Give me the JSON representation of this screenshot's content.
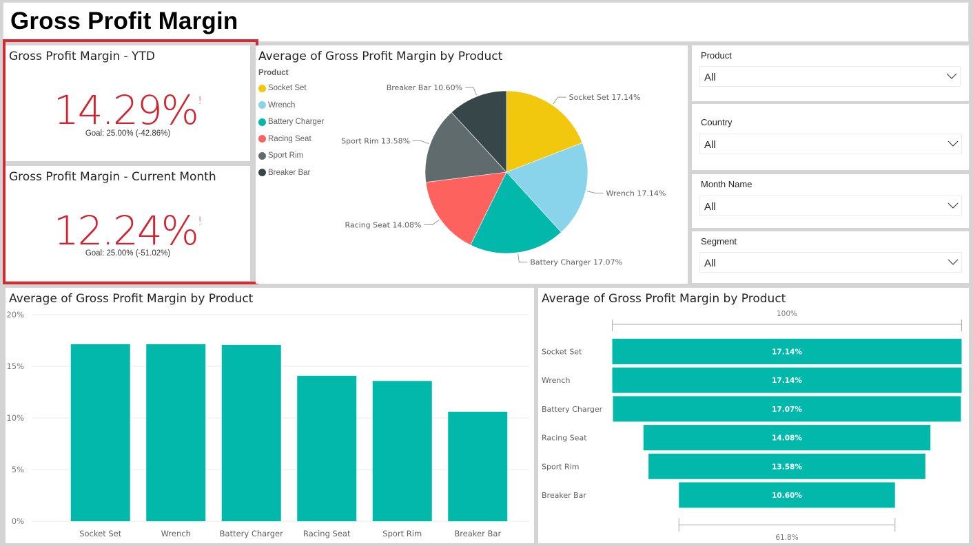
{
  "page": {
    "title": "Gross Profit Margin"
  },
  "kpis": [
    {
      "title": "Gross Profit Margin - YTD",
      "value": "14.29%",
      "indicator": "!",
      "goal_text": "Goal: 25.00% (-42.86%)",
      "color": "#d2222d"
    },
    {
      "title": "Gross Profit Margin - Current Month",
      "value": "12.24%",
      "indicator": "!",
      "goal_text": "Goal: 25.00% (-51.02%)",
      "color": "#d2222d"
    }
  ],
  "slicers": [
    {
      "label": "Product",
      "value": "All"
    },
    {
      "label": "Country",
      "value": "All"
    },
    {
      "label": "Month Name",
      "value": "All"
    },
    {
      "label": "Segment",
      "value": "All"
    }
  ],
  "pie": {
    "title": "Average of Gross Profit Margin by Product",
    "legend_title": "Product"
  },
  "bar": {
    "title": "Average of Gross Profit Margin by Product"
  },
  "funnel": {
    "title": "Average of Gross Profit Margin by Product",
    "top_label": "100%",
    "bottom_label": "61.8%"
  },
  "chart_data": [
    {
      "type": "pie",
      "title": "Average of Gross Profit Margin by Product",
      "legend_title": "Product",
      "legend_position": "top-left",
      "categories": [
        "Socket Set",
        "Wrench",
        "Battery Charger",
        "Racing Seat",
        "Sport Rim",
        "Breaker Bar"
      ],
      "values": [
        17.14,
        17.14,
        17.07,
        14.08,
        13.58,
        10.6
      ],
      "labels": [
        "Socket Set 17.14%",
        "Wrench 17.14%",
        "Battery Charger 17.07%",
        "Racing Seat 14.08%",
        "Sport Rim 13.58%",
        "Breaker Bar 10.60%"
      ],
      "colors": [
        "#f2c80f",
        "#8ad4eb",
        "#01b8aa",
        "#fd625e",
        "#5f6b6d",
        "#374649"
      ]
    },
    {
      "type": "bar",
      "title": "Average of Gross Profit Margin by Product",
      "xlabel": "",
      "ylabel": "",
      "categories": [
        "Socket Set",
        "Wrench",
        "Battery Charger",
        "Racing Seat",
        "Sport Rim",
        "Breaker Bar"
      ],
      "values": [
        17.14,
        17.14,
        17.07,
        14.08,
        13.58,
        10.6
      ],
      "ylim": [
        0,
        20
      ],
      "yticks": [
        "0%",
        "5%",
        "10%",
        "15%",
        "20%"
      ],
      "ytick_values": [
        0,
        5,
        10,
        15,
        20
      ],
      "grid": true,
      "color": "#01b8aa"
    },
    {
      "type": "funnel",
      "title": "Average of Gross Profit Margin by Product",
      "categories": [
        "Socket Set",
        "Wrench",
        "Battery Charger",
        "Racing Seat",
        "Sport Rim",
        "Breaker Bar"
      ],
      "values": [
        17.14,
        17.14,
        17.07,
        14.08,
        13.58,
        10.6
      ],
      "value_labels": [
        "17.14%",
        "17.14%",
        "17.07%",
        "14.08%",
        "13.58%",
        "10.60%"
      ],
      "top_percent_label": "100%",
      "bottom_percent_label": "61.8%",
      "color": "#01b8aa"
    }
  ]
}
